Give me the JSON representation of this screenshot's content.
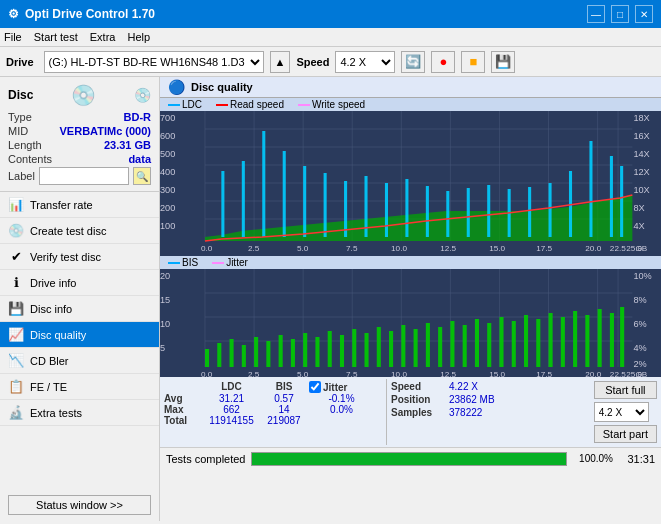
{
  "titlebar": {
    "title": "Opti Drive Control 1.70",
    "minimize": "—",
    "maximize": "□",
    "close": "✕"
  },
  "menubar": {
    "items": [
      "File",
      "Start test",
      "Extra",
      "Help"
    ]
  },
  "toolbar": {
    "drive_label": "Drive",
    "drive_value": "(G:)  HL-DT-ST BD-RE  WH16NS48 1.D3",
    "speed_label": "Speed",
    "speed_value": "4.2 X"
  },
  "sidebar": {
    "disc_section": {
      "type_label": "Type",
      "type_val": "BD-R",
      "mid_label": "MID",
      "mid_val": "VERBATIMc (000)",
      "length_label": "Length",
      "length_val": "23.31 GB",
      "contents_label": "Contents",
      "contents_val": "data",
      "label_label": "Label"
    },
    "nav_items": [
      {
        "id": "transfer",
        "label": "Transfer rate",
        "icon": "📊"
      },
      {
        "id": "create",
        "label": "Create test disc",
        "icon": "💿"
      },
      {
        "id": "verify",
        "label": "Verify test disc",
        "icon": "✔"
      },
      {
        "id": "driveinfo",
        "label": "Drive info",
        "icon": "ℹ"
      },
      {
        "id": "discinfo",
        "label": "Disc info",
        "icon": "💾"
      },
      {
        "id": "discquality",
        "label": "Disc quality",
        "icon": "📈",
        "active": true
      },
      {
        "id": "cdbler",
        "label": "CD Bler",
        "icon": "📉"
      },
      {
        "id": "fete",
        "label": "FE / TE",
        "icon": "📋"
      },
      {
        "id": "extratests",
        "label": "Extra tests",
        "icon": "🔬"
      }
    ],
    "status_btn": "Status window >>"
  },
  "disc_quality": {
    "title": "Disc quality",
    "icon": "🔵",
    "legend": {
      "ldc_label": "LDC",
      "read_label": "Read speed",
      "write_label": "Write speed",
      "bis_label": "BIS",
      "jitter_label": "Jitter"
    },
    "chart_top": {
      "y_max_left": 700,
      "y_max_right": 18,
      "x_max": 25,
      "x_label": "GB",
      "y_labels_left": [
        700,
        600,
        500,
        400,
        300,
        200,
        100
      ],
      "y_labels_right": [
        18,
        16,
        14,
        12,
        10,
        8,
        6,
        4,
        2
      ],
      "x_labels": [
        0.0,
        2.5,
        5.0,
        7.5,
        10.0,
        12.5,
        15.0,
        17.5,
        20.0,
        22.5,
        25.0
      ]
    },
    "chart_bottom": {
      "y_max_left": 20,
      "y_max_right": 10,
      "x_max": 25,
      "y_labels_left": [
        20,
        15,
        10,
        5
      ],
      "y_labels_right": [
        "10%",
        "8%",
        "6%",
        "4%",
        "2%"
      ],
      "x_labels": [
        0.0,
        2.5,
        5.0,
        7.5,
        10.0,
        12.5,
        15.0,
        17.5,
        20.0,
        22.5,
        25.0
      ]
    },
    "stats": {
      "avg_label": "Avg",
      "max_label": "Max",
      "total_label": "Total",
      "ldc_header": "LDC",
      "bis_header": "BIS",
      "jitter_header": "Jitter",
      "avg_ldc": "31.21",
      "avg_bis": "0.57",
      "avg_jitter": "-0.1%",
      "max_ldc": "662",
      "max_bis": "14",
      "max_jitter": "0.0%",
      "total_ldc": "11914155",
      "total_bis": "219087",
      "speed_label": "Speed",
      "speed_val": "4.22 X",
      "position_label": "Position",
      "position_val": "23862 MB",
      "samples_label": "Samples",
      "samples_val": "378222",
      "jitter_checked": true,
      "speed_select": "4.2 X",
      "btn_full": "Start full",
      "btn_part": "Start part"
    }
  },
  "statusbar": {
    "text": "Tests completed",
    "progress": 100,
    "progress_label": "100.0%",
    "time": "31:31"
  }
}
